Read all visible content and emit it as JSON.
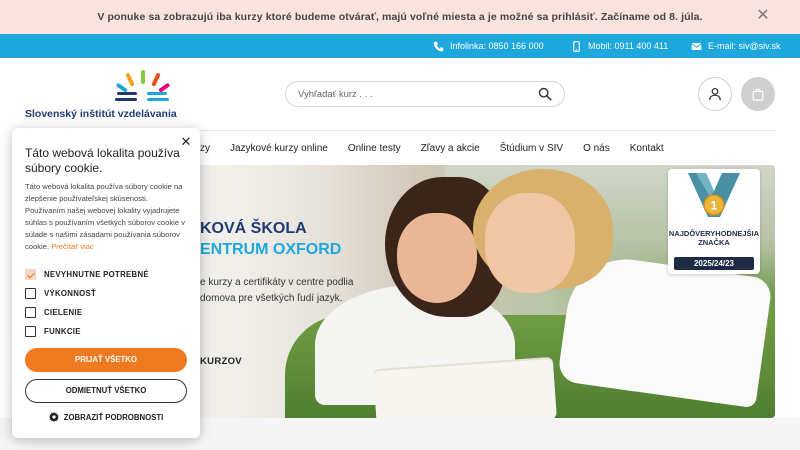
{
  "notice": {
    "text": "V ponuke sa zobrazujú iba kurzy ktoré budeme otvárať, majú voľné miesta a je možné sa prihlásiť. Začíname od 8. júla.",
    "close_glyph": "✕"
  },
  "contact": {
    "infolinka": "Infolinka: 0850 166 000",
    "mobil": "Mobil: 0911 400 411",
    "email": "E-mail: siv@siv.sk"
  },
  "header": {
    "logo_text": "Slovenský inštitút vzdelávania",
    "search_placeholder": "Vyhľadať kurz . . ."
  },
  "nav": {
    "items": [
      {
        "label": "zy"
      },
      {
        "label": "Jazykové kurzy online"
      },
      {
        "label": "Online testy"
      },
      {
        "label": "Zľavy a akcie"
      },
      {
        "label": "Štúdium v SIV"
      },
      {
        "label": "O nás"
      },
      {
        "label": "Kontakt"
      }
    ]
  },
  "hero": {
    "title_line1": "KOVÁ ŠKOLA",
    "title_line2": "ENTRUM OXFORD",
    "subtitle": "e kurzy a certifikáty v centre podlia domova pre všetkých ľudí jazyk.",
    "cta": "KURZOV",
    "badge": {
      "rank": "1",
      "line1": "NAJDÔVERYHODNEJŠIA",
      "line2": "ZNAČKA",
      "years": "2025/24/23"
    }
  },
  "cookie": {
    "title": "Táto webová lokalita používa súbory cookie.",
    "body": "Táto webová lokalita používa súbory cookie na zlepšenie používateľskej skúsenosti. Používaním našej webovej lokality vyjadrujete súhlas s používaním všetkých súborov cookie v súlade s našimi zásadami používania súborov cookie.",
    "link": "Prečítať viac",
    "options": [
      {
        "label": "NEVYHNUTNE POTREBNÉ",
        "checked": true
      },
      {
        "label": "VÝKONNOSŤ",
        "checked": false
      },
      {
        "label": "CIELENIE",
        "checked": false
      },
      {
        "label": "FUNKCIE",
        "checked": false
      }
    ],
    "accept": "PRIJAŤ VŠETKO",
    "reject": "ODMIETNUŤ VŠETKO",
    "details": "ZOBRAZIŤ PODROBNOSTI"
  },
  "colors": {
    "accent_orange": "#f07a1f",
    "brand_blue": "#1ea7dd",
    "brand_navy": "#1f3a73",
    "notice_bg": "#f9e3df"
  }
}
